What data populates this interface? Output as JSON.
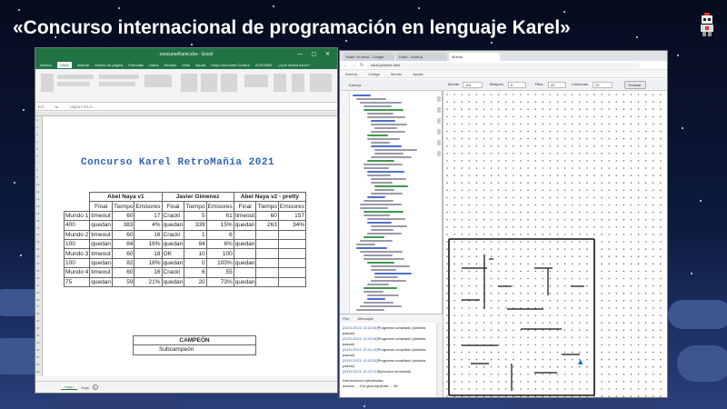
{
  "overlay": {
    "title": "«Concurso internacional de programación en lenguaje Karel»",
    "mascot_icon": "robot-mascot-icon"
  },
  "excel": {
    "window_title": "concursoKarel.xlsx - Excel",
    "window_controls": "— ▢ ✕",
    "ribbon_tabs": [
      "Archivo",
      "Inicio",
      "Insertar",
      "Diseño de página",
      "Fórmulas",
      "Datos",
      "Revisar",
      "Vista",
      "Ayuda",
      "Easy Document Creator",
      "ACROBAT",
      "¿Qué desea hacer?"
    ],
    "active_tab": "Inicio",
    "name_box": "F27",
    "formula_prefix": "fx",
    "formula": "=SI(D17+F17<...",
    "sheet_title": "Concurso Karel  RetroMañía 2021",
    "contestants": [
      "Abel Naya v1",
      "Javier Gimenez",
      "Abel Naya v2 - pretty"
    ],
    "subheaders": [
      "Final",
      "Tiempo",
      "Emisores"
    ],
    "rows": [
      {
        "label": "Mundo 1",
        "a": [
          "timeout",
          "60",
          "17"
        ],
        "b": [
          "Crackl",
          "5",
          "61"
        ],
        "c": [
          "timeout",
          "60",
          "157"
        ]
      },
      {
        "label": "400",
        "a": [
          "quedan",
          "383",
          "4%"
        ],
        "b": [
          "quedan",
          "339",
          "15%"
        ],
        "c": [
          "quedan",
          "263",
          "34%"
        ]
      },
      {
        "label": "Mundo 2",
        "a": [
          "timeout",
          "60",
          "16"
        ],
        "b": [
          "Crackl",
          "1",
          "6"
        ],
        "c": [
          "",
          "",
          ""
        ]
      },
      {
        "label": "100",
        "a": [
          "quedan",
          "84",
          "16%"
        ],
        "b": [
          "quedan",
          "94",
          "6%"
        ],
        "c": [
          "quedan",
          "",
          ""
        ]
      },
      {
        "label": "Mundo 3",
        "a": [
          "timeout",
          "60",
          "18"
        ],
        "b": [
          "OK",
          "10",
          "100"
        ],
        "c": [
          "",
          "",
          ""
        ]
      },
      {
        "label": "100",
        "a": [
          "quedan",
          "82",
          "18%"
        ],
        "b": [
          "quedan",
          "0",
          "100%"
        ],
        "c": [
          "quedan",
          "",
          ""
        ]
      },
      {
        "label": "Mundo 4",
        "a": [
          "timeout",
          "60",
          "16"
        ],
        "b": [
          "Crackl",
          "6",
          "55"
        ],
        "c": [
          "",
          "",
          ""
        ]
      },
      {
        "label": "75",
        "a": [
          "quedan",
          "59",
          "21%"
        ],
        "b": [
          "quedan",
          "20",
          "73%"
        ],
        "c": [
          "quedan",
          "",
          ""
        ]
      }
    ],
    "champion_label": "CAMPEÓN",
    "runnerup_label": "Subcampeón",
    "sheet_tab": "Hoja1",
    "sheet_tab2": "Hoja",
    "add_sheet": "+"
  },
  "browser": {
    "tabs": [
      "Karel: el robot - Google",
      "Karel - Karel.js",
      "Mundo"
    ],
    "url": "karel.js/index.html",
    "menu": [
      "Karel.js",
      "Código",
      "Mundo",
      "Ayuda"
    ],
    "editor_mode": "Karel.js",
    "world_fields": {
      "mundo_label": "Mundo",
      "mundo_value": "101",
      "beepers_label": "Beepers",
      "beepers_value": "0",
      "filas_label": "Filas",
      "filas_value": "20",
      "columnas_label": "Columnas",
      "columnas_value": "20",
      "evaluate_label": "Evaluar"
    },
    "log_tabs": [
      "Pila",
      "Mensajes"
    ],
    "log": [
      {
        "ts": "[20/11/2021 13:43:36]",
        "msg": "Programa compilado (sintaxis pascal)"
      },
      {
        "ts": "[20/11/2021 13:43:48]",
        "msg": "Programa compilado (sintaxis pascal)"
      },
      {
        "ts": "[20/11/2021 13:44:15]",
        "msg": "Programa compilado (sintaxis pascal)"
      },
      {
        "ts": "[20/11/2021 13:42:55]",
        "msg": "Programa compilado (sintaxis pascal)"
      },
      {
        "ts": "[20/11/2021 13:43:12]",
        "msg": "Ejecución terminada"
      }
    ],
    "log_footer": "Instrucciones ejecutadas:",
    "log_footer_values": "avance ... 134  gira-izquierda ... 28"
  }
}
